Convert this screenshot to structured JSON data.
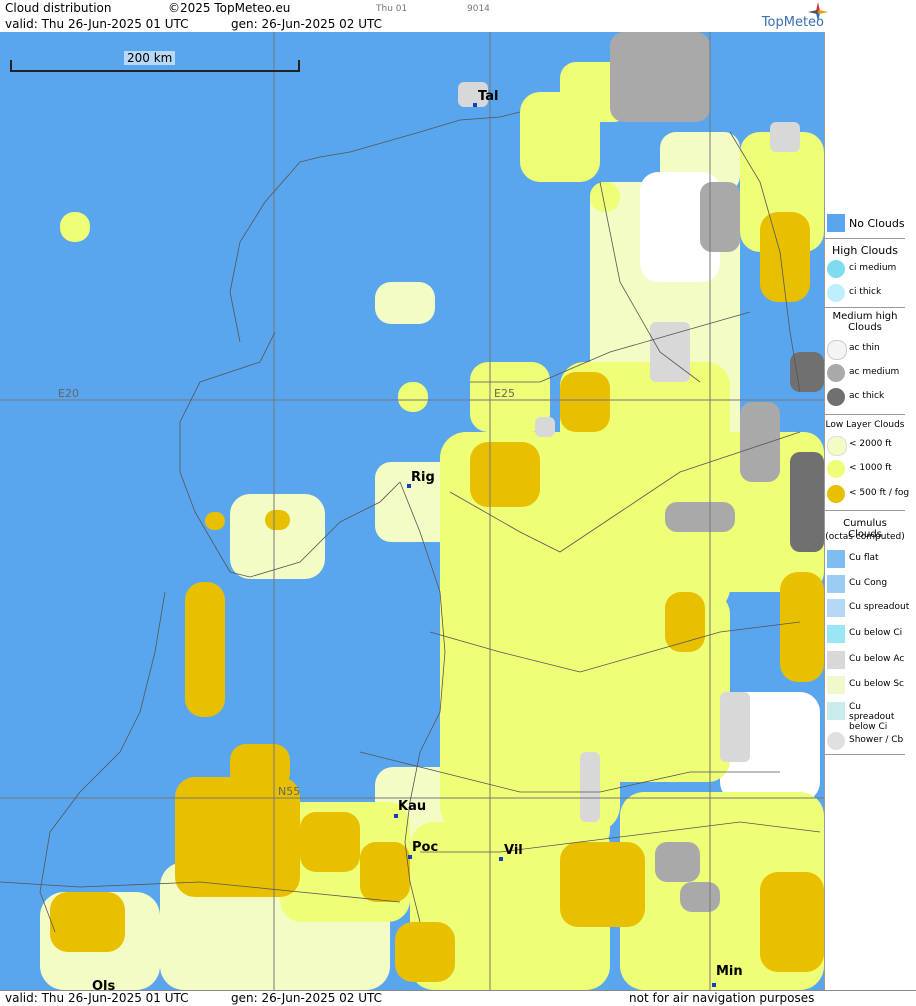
{
  "header": {
    "title": "Cloud distribution",
    "copyright": "©2025 TopMeteo.eu",
    "run_label": "Thu 01",
    "code": "9014",
    "valid": "valid:  Thu  26-Jun-2025  01 UTC",
    "generated": "gen: 26-Jun-2025 02 UTC",
    "brand": "TopMeteo"
  },
  "footer": {
    "valid": "valid:  Thu  26-Jun-2025  01 UTC",
    "generated": "gen: 26-Jun-2025 02 UTC",
    "disclaimer": "not for air navigation purposes"
  },
  "map": {
    "scale_label": "200 km",
    "grid_labels": {
      "lon_20": "E20",
      "lon_25": "E25",
      "lat_55": "N55"
    },
    "cities": [
      {
        "code": "Tal"
      },
      {
        "code": "Rig"
      },
      {
        "code": "Kau"
      },
      {
        "code": "Poc"
      },
      {
        "code": "Vil"
      },
      {
        "code": "Ols"
      },
      {
        "code": "Min"
      }
    ]
  },
  "legend": {
    "no_clouds": "No Clouds",
    "high_title": "High Clouds",
    "high_items": [
      "ci medium",
      "ci thick"
    ],
    "medium_title": "Medium high Clouds",
    "medium_items": [
      "ac thin",
      "ac medium",
      "ac thick"
    ],
    "low_title": "Low Layer Clouds",
    "low_items": [
      "< 2000 ft",
      "< 1000 ft",
      "< 500 ft / fog"
    ],
    "cu_title": "Cumulus Clouds",
    "cu_subtitle": "(octas computed)",
    "cu_items": [
      "Cu flat",
      "Cu Cong",
      "Cu spreadout",
      "Cu below Ci",
      "Cu below Ac",
      "Cu below Sc",
      "Cu spreadout below Ci",
      "Shower / Cb"
    ]
  },
  "colors": {
    "water_no_clouds": "#5aa6ee",
    "low_2000": "#f2fcc4",
    "low_1000": "#eefe76",
    "low_500": "#e8c000",
    "ac_thin": "#f4f4f4",
    "ac_medium": "#a9a9a9",
    "ac_thick": "#707070",
    "ci_medium": "#7fdcf0",
    "ci_thick": "#bfefff"
  }
}
